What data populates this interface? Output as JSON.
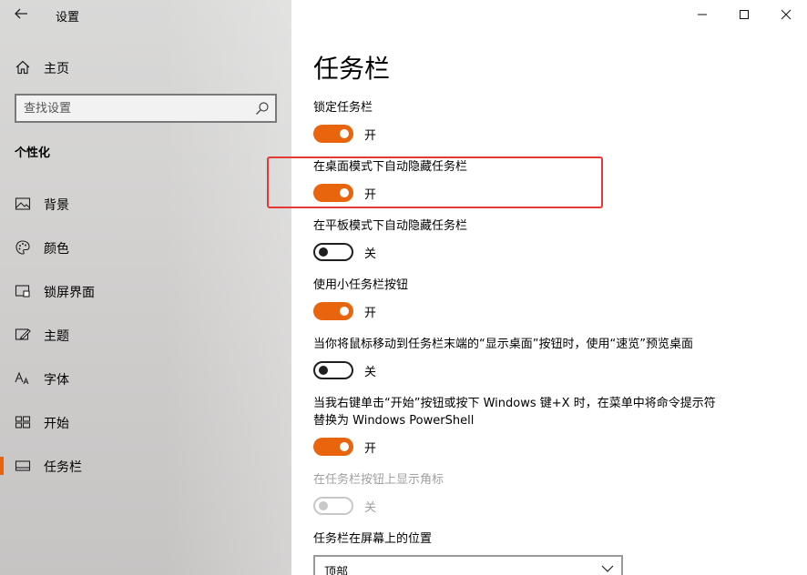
{
  "app": {
    "title": "设置"
  },
  "sidebar": {
    "home_label": "主页",
    "search_placeholder": "查找设置",
    "section_title": "个性化",
    "items": [
      {
        "label": "背景",
        "icon": "image-icon"
      },
      {
        "label": "颜色",
        "icon": "palette-icon"
      },
      {
        "label": "锁屏界面",
        "icon": "lock-screen-icon"
      },
      {
        "label": "主题",
        "icon": "theme-icon"
      },
      {
        "label": "字体",
        "icon": "font-icon"
      },
      {
        "label": "开始",
        "icon": "start-icon"
      },
      {
        "label": "任务栏",
        "icon": "taskbar-icon",
        "active": true
      }
    ]
  },
  "main": {
    "title": "任务栏",
    "settings": [
      {
        "label": "锁定任务栏",
        "state": "开",
        "on": true,
        "enabled": true
      },
      {
        "label": "在桌面模式下自动隐藏任务栏",
        "state": "开",
        "on": true,
        "enabled": true
      },
      {
        "label": "在平板模式下自动隐藏任务栏",
        "state": "关",
        "on": false,
        "enabled": true
      },
      {
        "label": "使用小任务栏按钮",
        "state": "开",
        "on": true,
        "enabled": true
      },
      {
        "label": "当你将鼠标移动到任务栏末端的“显示桌面”按钮时，使用“速览”预览桌面",
        "state": "关",
        "on": false,
        "enabled": true
      },
      {
        "label": "当我右键单击“开始”按钮或按下 Windows 键+X 时，在菜单中将命令提示符替换为 Windows PowerShell",
        "state": "开",
        "on": true,
        "enabled": true
      },
      {
        "label": "在任务栏按钮上显示角标",
        "state": "关",
        "on": false,
        "enabled": false
      }
    ],
    "position_label": "任务栏在屏幕上的位置",
    "position_value": "顶部"
  },
  "colors": {
    "accent": "#e8650e",
    "highlight": "#e53935"
  }
}
